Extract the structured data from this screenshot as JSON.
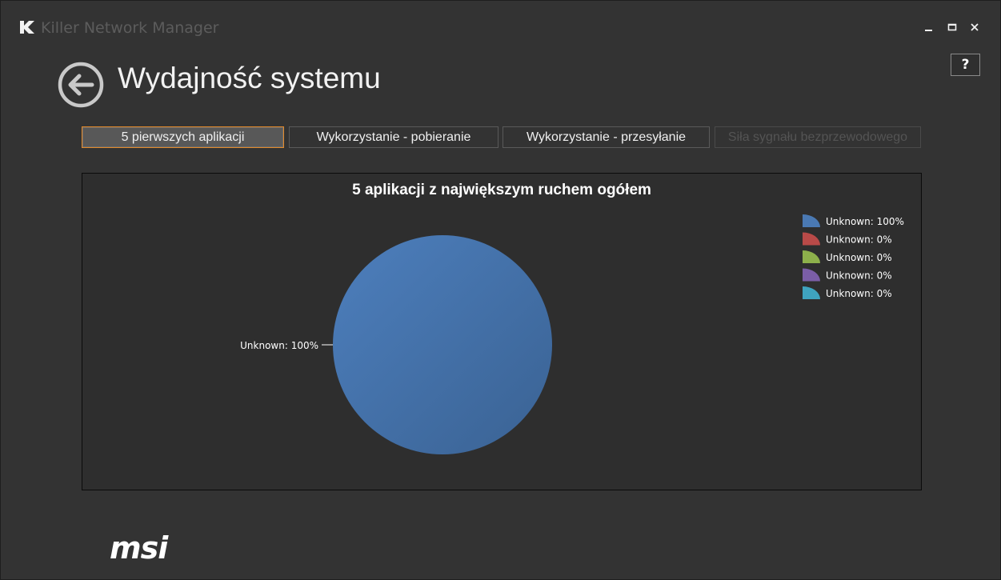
{
  "window": {
    "app_title": "Killer Network Manager",
    "logo_letter": "K",
    "minimize_label": "_",
    "maximize_label": "□",
    "close_label": "✕",
    "help_label": "?"
  },
  "header": {
    "back_icon": "back-arrow-icon",
    "title": "Wydajność systemu"
  },
  "tabs": [
    {
      "label": "5 pierwszych aplikacji",
      "state": "active"
    },
    {
      "label": "Wykorzystanie - pobieranie",
      "state": "normal"
    },
    {
      "label": "Wykorzystanie - przesyłanie",
      "state": "normal"
    },
    {
      "label": "Siła sygnału bezprzewodowego",
      "state": "disabled"
    }
  ],
  "colors": {
    "accent_active_tab": "#e38a2a",
    "background": "#333333",
    "chart_background": "#2e2e2e"
  },
  "chart_data": {
    "type": "pie",
    "title": "5 aplikacji z największym ruchem ogółem",
    "categories": [
      "Unknown",
      "Unknown",
      "Unknown",
      "Unknown",
      "Unknown"
    ],
    "values": [
      100,
      0,
      0,
      0,
      0
    ],
    "legend": [
      {
        "label": "Unknown: 100%",
        "color": "#4a79b3"
      },
      {
        "label": "Unknown: 0%",
        "color": "#b94a48"
      },
      {
        "label": "Unknown: 0%",
        "color": "#8db04b"
      },
      {
        "label": "Unknown: 0%",
        "color": "#7b5ea7"
      },
      {
        "label": "Unknown: 0%",
        "color": "#3fa3bf"
      }
    ],
    "slice_labels": [
      "Unknown: 100%"
    ],
    "legend_position": "top-right"
  },
  "footer": {
    "brand": "msi"
  }
}
